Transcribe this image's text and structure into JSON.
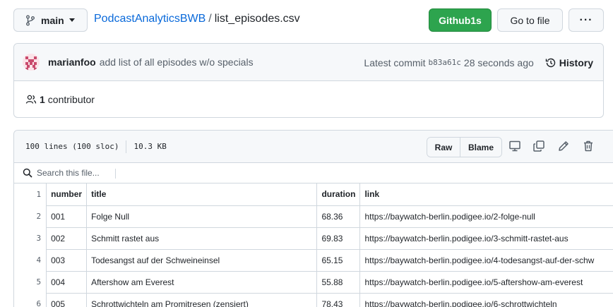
{
  "topbar": {
    "branch": "main",
    "repo": "PodcastAnalyticsBWB",
    "separator": "/",
    "file": "list_episodes.csv",
    "github1s_label": "Github1s",
    "goto_label": "Go to file",
    "more_label": "···"
  },
  "commit": {
    "author": "marianfoo",
    "message": "add list of all episodes w/o specials",
    "latest_label": "Latest commit",
    "sha": "b83a61c",
    "time": "28 seconds ago",
    "history_label": "History"
  },
  "contributors": {
    "count": "1",
    "label": "contributor"
  },
  "file": {
    "lines": "100 lines (100 sloc)",
    "size": "10.3 KB",
    "raw_label": "Raw",
    "blame_label": "Blame",
    "search_placeholder": "Search this file..."
  },
  "table": {
    "headers": {
      "line": "1",
      "number": "number",
      "title": "title",
      "duration": "duration",
      "link": "link"
    },
    "rows": [
      {
        "line": "2",
        "number": "001",
        "title": "Folge Null",
        "duration": "68.36",
        "link": "https://baywatch-berlin.podigee.io/2-folge-null"
      },
      {
        "line": "3",
        "number": "002",
        "title": "Schmitt rastet aus",
        "duration": "69.83",
        "link": "https://baywatch-berlin.podigee.io/3-schmitt-rastet-aus"
      },
      {
        "line": "4",
        "number": "003",
        "title": "Todesangst auf der Schweineinsel",
        "duration": "65.15",
        "link": "https://baywatch-berlin.podigee.io/4-todesangst-auf-der-schw"
      },
      {
        "line": "5",
        "number": "004",
        "title": "Aftershow am Everest",
        "duration": "55.88",
        "link": "https://baywatch-berlin.podigee.io/5-aftershow-am-everest"
      },
      {
        "line": "6",
        "number": "005",
        "title": "Schrottwichteln am Promitresen (zensiert)",
        "duration": "78.43",
        "link": "https://baywatch-berlin.podigee.io/6-schrottwichteln"
      }
    ]
  },
  "colors": {
    "accent": "#0969da",
    "primary_button": "#2da44e",
    "border": "#d0d7de",
    "muted": "#57606a"
  },
  "icons": [
    "git-branch-icon",
    "history-icon",
    "people-icon",
    "search-icon",
    "desktop-icon",
    "copy-icon",
    "pencil-icon",
    "trash-icon",
    "kebab-icon"
  ]
}
